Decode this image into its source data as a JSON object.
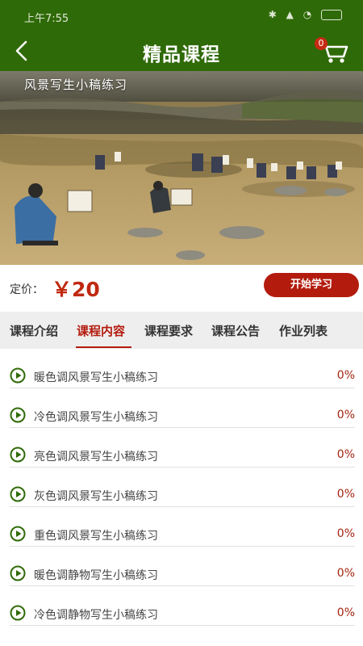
{
  "status_bar": {
    "time": "上午7:55"
  },
  "header": {
    "title": "精品课程",
    "cart_count": "0"
  },
  "hero": {
    "caption": "风景写生小稿练习"
  },
  "price": {
    "label": "定价：",
    "value": "￥20",
    "button": "开始学习"
  },
  "tabs": [
    {
      "label": "课程介绍"
    },
    {
      "label": "课程内容"
    },
    {
      "label": "课程要求"
    },
    {
      "label": "课程公告"
    },
    {
      "label": "作业列表"
    }
  ],
  "active_tab": "课程内容",
  "lessons": [
    {
      "title": "暖色调风景写生小稿练习",
      "progress": "0%"
    },
    {
      "title": "冷色调风景写生小稿练习",
      "progress": "0%"
    },
    {
      "title": "亮色调风景写生小稿练习",
      "progress": "0%"
    },
    {
      "title": "灰色调风景写生小稿练习",
      "progress": "0%"
    },
    {
      "title": "重色调风景写生小稿练习",
      "progress": "0%"
    },
    {
      "title": "暖色调静物写生小稿练习",
      "progress": "0%"
    },
    {
      "title": "冷色调静物写生小稿练习",
      "progress": "0%"
    }
  ],
  "colors": {
    "header": "#2f6a08",
    "accent": "#b31b0d",
    "tab_bg": "#eeeeee",
    "play_icon": "#2f6a08"
  }
}
